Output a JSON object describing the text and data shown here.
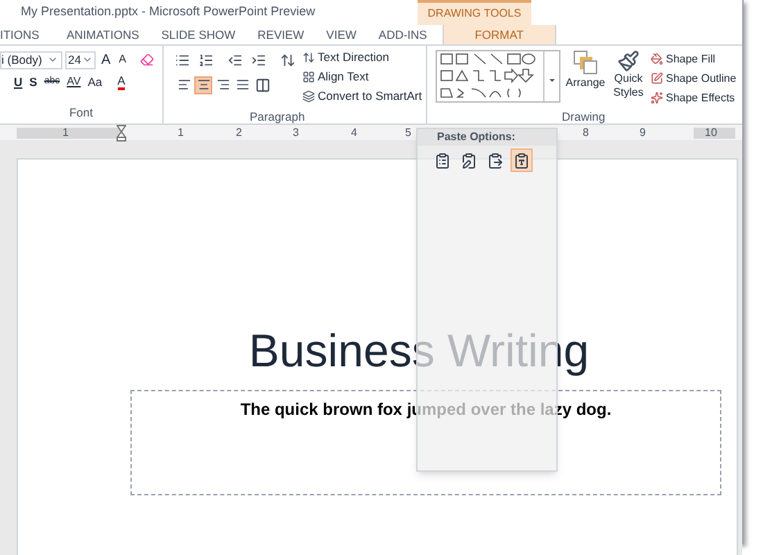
{
  "window": {
    "title": "My Presentation.pptx - Microsoft PowerPoint Preview"
  },
  "contextual_group": "DRAWING TOOLS",
  "tabs": [
    {
      "label": "ITIONS",
      "selected": false
    },
    {
      "label": "ANIMATIONS",
      "selected": false
    },
    {
      "label": "SLIDE SHOW",
      "selected": false
    },
    {
      "label": "REVIEW",
      "selected": false
    },
    {
      "label": "VIEW",
      "selected": false
    },
    {
      "label": "ADD-INS",
      "selected": false
    },
    {
      "label": "FORMAT",
      "selected": true
    }
  ],
  "font_group": {
    "label": "Font",
    "font_name": "i (Body)",
    "font_size": "24",
    "grow": "A",
    "shrink": "A",
    "underline": "U",
    "shadow": "S",
    "strikethrough": "abc",
    "spacing": "AV",
    "change_case": "Aa",
    "font_color": "A"
  },
  "paragraph_group": {
    "label": "Paragraph",
    "alignment": [
      {
        "kind": "left",
        "selected": false
      },
      {
        "kind": "center",
        "selected": true
      },
      {
        "kind": "right",
        "selected": false
      },
      {
        "kind": "justify",
        "selected": false
      }
    ],
    "commands": [
      "Text Direction",
      "Align Text",
      "Convert to SmartArt"
    ]
  },
  "drawing_group": {
    "label": "Drawing",
    "arrange": "Arrange",
    "quick_styles": [
      "Quick",
      "Styles"
    ],
    "shape_commands": [
      "Shape Fill",
      "Shape Outline",
      "Shape Effects"
    ]
  },
  "ruler": [
    "1",
    "1",
    "2",
    "3",
    "4",
    "5",
    "8",
    "9",
    "10"
  ],
  "paste_options": {
    "title": "Paste Options:",
    "options": [
      {
        "kind": "theme",
        "selected": false
      },
      {
        "kind": "source",
        "selected": false
      },
      {
        "kind": "picture",
        "selected": false
      },
      {
        "kind": "text",
        "selected": true
      }
    ]
  },
  "slide": {
    "title": "Business Writing",
    "body": "The quick brown fox jumped over the lazy dog."
  }
}
